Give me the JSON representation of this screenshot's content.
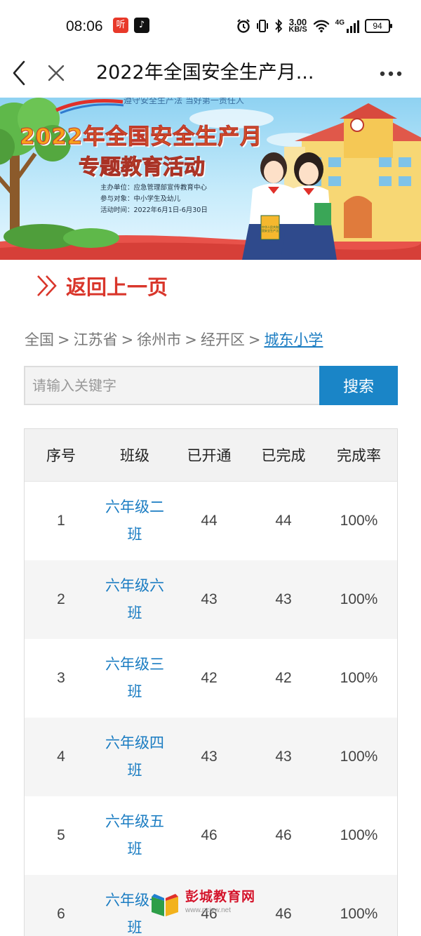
{
  "status_bar": {
    "time": "08:06",
    "app_icon_ting": "听",
    "net_speed_value": "3.00",
    "net_speed_unit": "KB/S",
    "network_type": "4G",
    "battery": "94",
    "icons": [
      "alarm-icon",
      "vibrate-icon",
      "bluetooth-icon",
      "wifi-icon",
      "signal-icon",
      "battery-icon"
    ]
  },
  "titlebar": {
    "title": "2022年全国安全生产月..."
  },
  "banner": {
    "slogan": "遵守安全生产法 当好第一责任人",
    "headline_1": "2022年全国安全生产月",
    "headline_2": "专题教育活动",
    "organizer": "主办单位：应急管理部宣传教育中心",
    "audience": "参与对象：中小学生及幼儿",
    "period": "活动时间：2022年6月1日-6月30日",
    "book_text": "中华人民共和国安全生产法"
  },
  "back_link": {
    "label": "返回上一页"
  },
  "breadcrumb": {
    "items": [
      "全国",
      "江苏省",
      "徐州市",
      "经开区"
    ],
    "current": "城东小学",
    "separator": ">"
  },
  "search": {
    "placeholder": "请输入关键字",
    "value": "",
    "button_label": "搜索"
  },
  "table": {
    "headers": [
      "序号",
      "班级",
      "已开通",
      "已完成",
      "完成率"
    ],
    "rows": [
      {
        "no": "1",
        "class": "六年级二班",
        "opened": "44",
        "completed": "44",
        "rate": "100%"
      },
      {
        "no": "2",
        "class": "六年级六班",
        "opened": "43",
        "completed": "43",
        "rate": "100%"
      },
      {
        "no": "3",
        "class": "六年级三班",
        "opened": "42",
        "completed": "42",
        "rate": "100%"
      },
      {
        "no": "4",
        "class": "六年级四班",
        "opened": "43",
        "completed": "43",
        "rate": "100%"
      },
      {
        "no": "5",
        "class": "六年级五班",
        "opened": "46",
        "completed": "46",
        "rate": "100%"
      },
      {
        "no": "6",
        "class": "六年级一班",
        "opened": "46",
        "completed": "46",
        "rate": "100%"
      }
    ]
  },
  "watermark": {
    "text": "彭城教育网",
    "subtext": "www.pcjyw.net"
  },
  "colors": {
    "accent_blue": "#1a85c7",
    "link_blue": "#1a7cc2",
    "back_red": "#d9362b",
    "header_bg": "#f2f2f2",
    "row_alt_bg": "#f5f5f5"
  }
}
